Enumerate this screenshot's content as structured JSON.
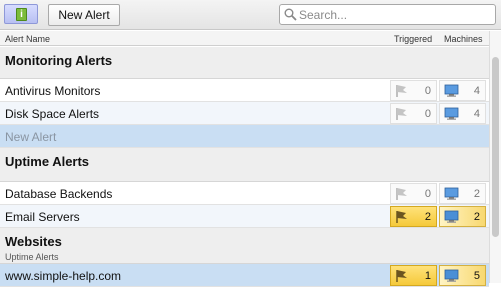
{
  "toolbar": {
    "info_icon_char": "i",
    "new_alert_label": "New Alert",
    "search_placeholder": "Search..."
  },
  "columns": {
    "name": "Alert Name",
    "triggered": "Triggered",
    "machines": "Machines"
  },
  "groups": [
    {
      "title": "Monitoring Alerts",
      "subtitle": "",
      "rows": [
        {
          "name": "Antivirus Monitors",
          "triggered": "0",
          "machines": "4",
          "active": false
        },
        {
          "name": "Disk Space Alerts",
          "triggered": "0",
          "machines": "4",
          "active": false
        },
        {
          "name": "New Alert",
          "placeholder": true
        }
      ]
    },
    {
      "title": "Uptime Alerts",
      "subtitle": "",
      "rows": [
        {
          "name": "Database Backends",
          "triggered": "0",
          "machines": "2",
          "active": false
        },
        {
          "name": "Email Servers",
          "triggered": "2",
          "machines": "2",
          "active": true
        }
      ]
    },
    {
      "title": "Websites",
      "subtitle": "Uptime Alerts",
      "rows": [
        {
          "name": "www.simple-help.com",
          "triggered": "1",
          "machines": "5",
          "active": true
        }
      ]
    }
  ],
  "icons": {
    "info": "info-icon",
    "search": "magnifier-icon",
    "triggered": "flag-icon",
    "machines": "monitor-icon"
  },
  "colors": {
    "active_cell": "#f5c93a",
    "selected_row": "#c9def3",
    "info_button": "#b8c0f2"
  }
}
